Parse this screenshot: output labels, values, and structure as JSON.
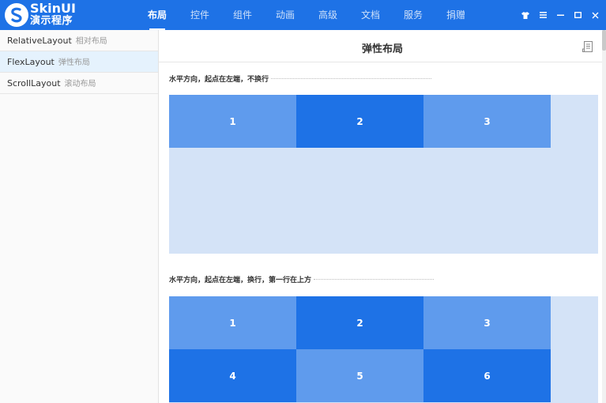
{
  "app": {
    "brand_line1": "SkinUI",
    "brand_line2": "演示程序",
    "accent_color": "#1e72e6"
  },
  "nav": {
    "items": [
      {
        "label": "布局",
        "active": true
      },
      {
        "label": "控件",
        "active": false
      },
      {
        "label": "组件",
        "active": false
      },
      {
        "label": "动画",
        "active": false
      },
      {
        "label": "高级",
        "active": false
      },
      {
        "label": "文档",
        "active": false
      },
      {
        "label": "服务",
        "active": false
      },
      {
        "label": "捐赠",
        "active": false
      }
    ]
  },
  "window_controls": [
    "shirt-icon",
    "menu-icon",
    "minimize-icon",
    "maximize-icon",
    "close-icon"
  ],
  "sidebar": {
    "items": [
      {
        "label": "RelativeLayout",
        "sub": "相对布局",
        "active": false
      },
      {
        "label": "FlexLayout",
        "sub": "弹性布局",
        "active": true
      },
      {
        "label": "ScrollLayout",
        "sub": "滚动布局",
        "active": false
      }
    ]
  },
  "main": {
    "title": "弹性布局",
    "sections": [
      {
        "label": "水平方向，起点在左端，不换行",
        "cells": [
          "1",
          "2",
          "3"
        ]
      },
      {
        "label": "水平方向，起点在左端，换行，第一行在上方",
        "cells": [
          "1",
          "2",
          "3",
          "4",
          "5",
          "6"
        ]
      }
    ]
  }
}
